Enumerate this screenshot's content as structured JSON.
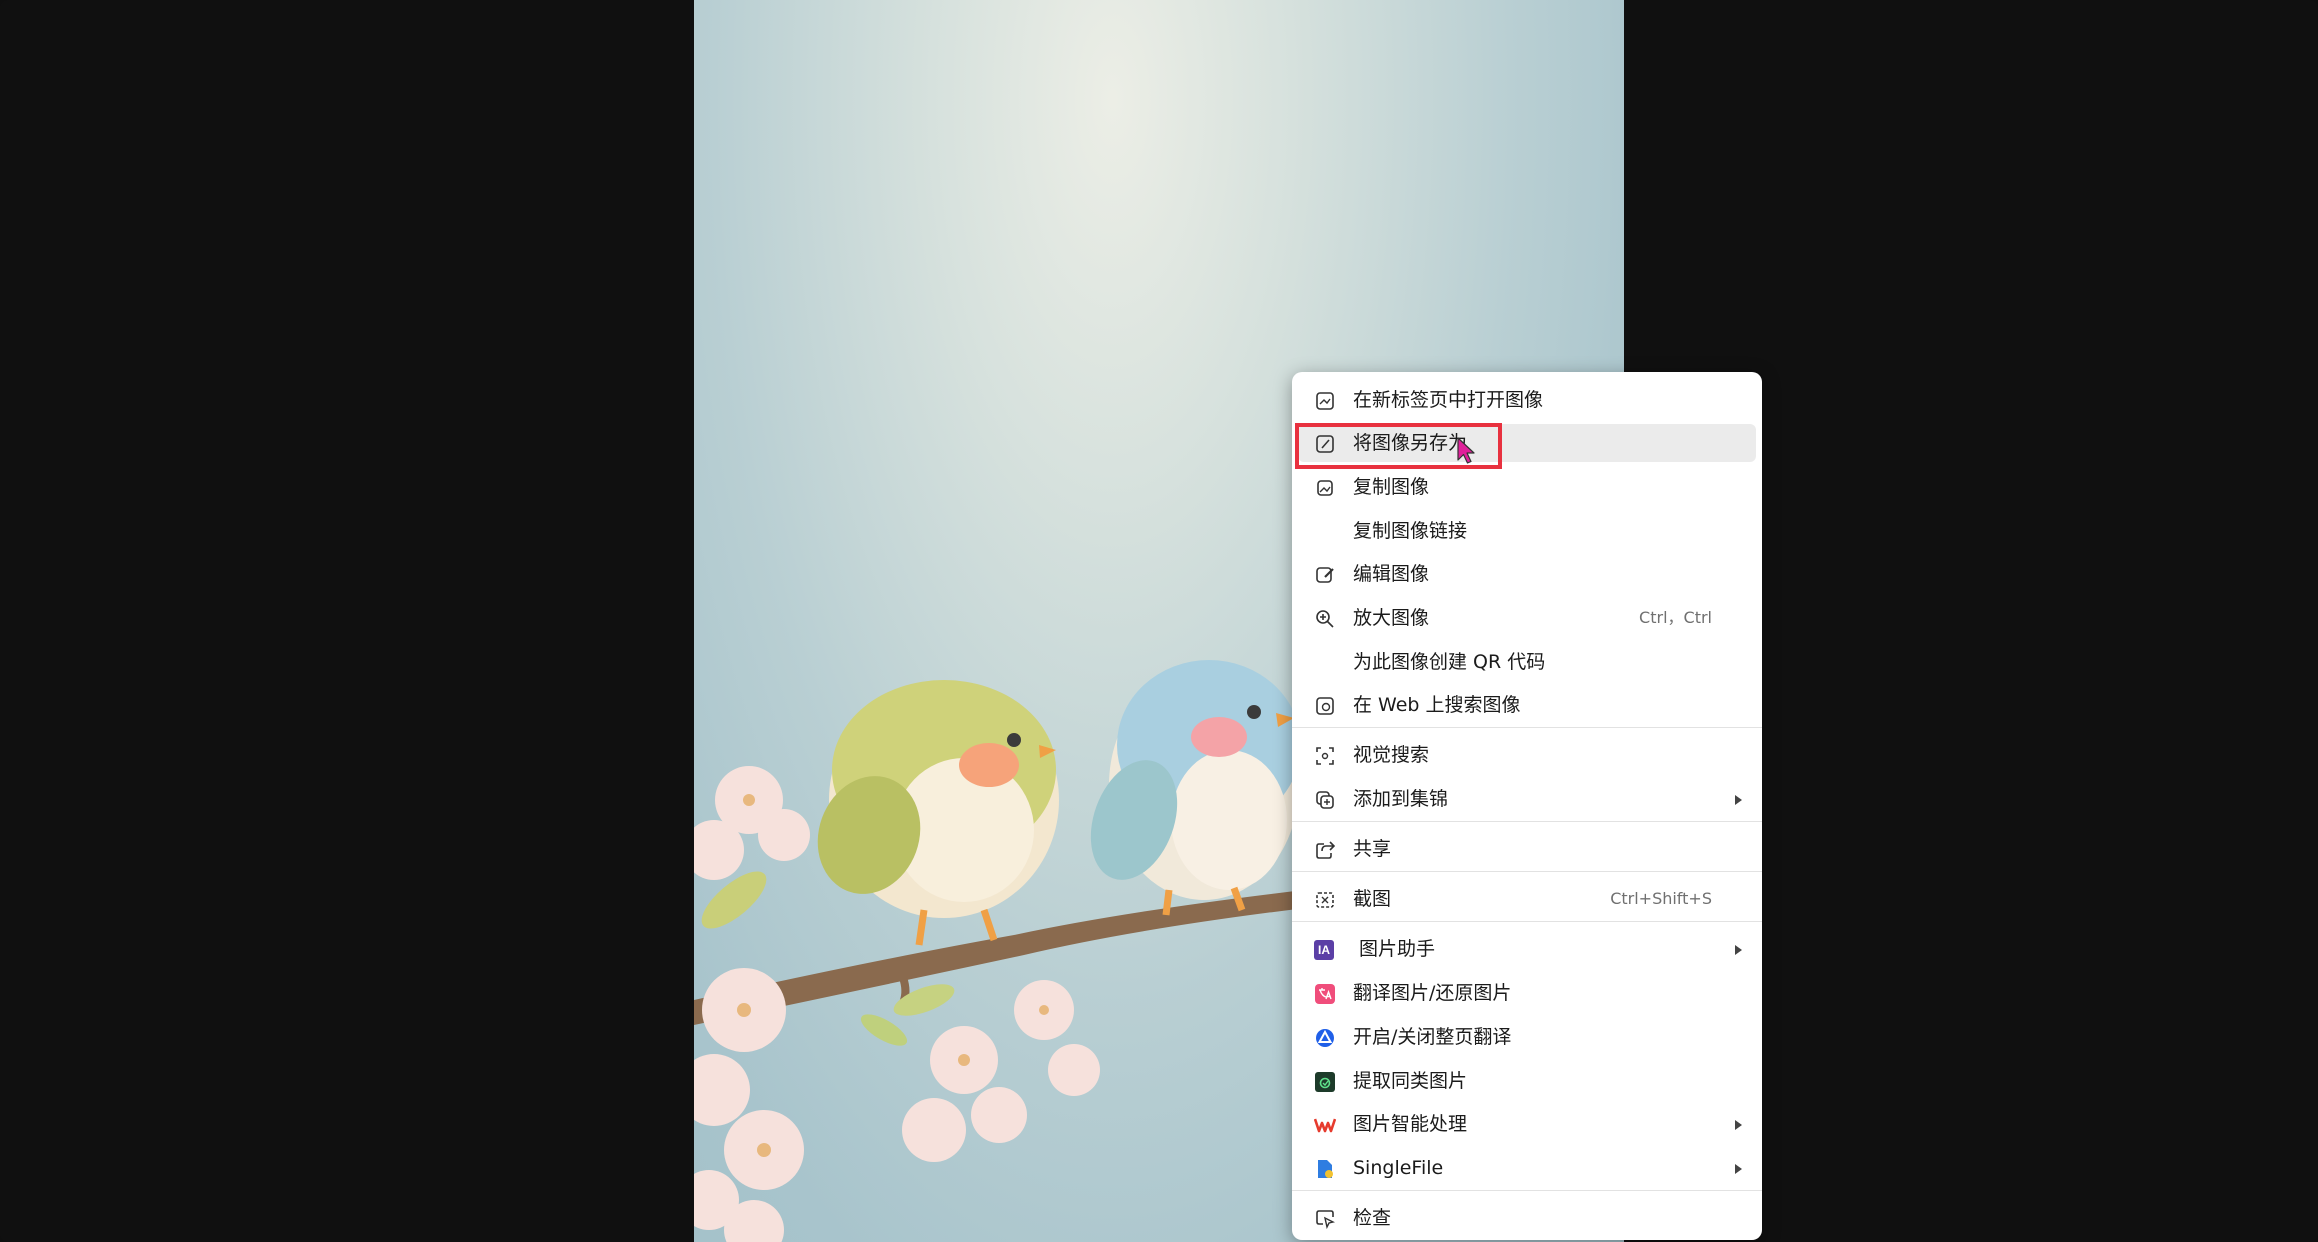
{
  "menu": {
    "items": [
      {
        "label": "在新标签页中打开图像",
        "icon": "open-in-new-tab-icon"
      },
      {
        "label": "将图像另存为",
        "icon": "save-image-icon",
        "highlighted": true
      },
      {
        "label": "复制图像",
        "icon": "copy-image-icon"
      },
      {
        "label": "复制图像链接",
        "icon": ""
      },
      {
        "label": "编辑图像",
        "icon": "edit-image-icon"
      },
      {
        "label": "放大图像",
        "icon": "zoom-in-icon",
        "shortcut": "Ctrl，Ctrl"
      },
      {
        "label": "为此图像创建 QR 代码",
        "icon": ""
      },
      {
        "label": "在 Web 上搜索图像",
        "icon": "web-image-search-icon"
      },
      {
        "label": "视觉搜索",
        "icon": "visual-search-icon"
      },
      {
        "label": "添加到集锦",
        "icon": "collections-icon",
        "submenu": true
      },
      {
        "label": "共享",
        "icon": "share-icon"
      },
      {
        "label": "截图",
        "icon": "screenshot-icon",
        "shortcut": "Ctrl+Shift+S"
      },
      {
        "label": "图片助手",
        "icon": "image-assistant-icon",
        "submenu": true
      },
      {
        "label": "翻译图片/还原图片",
        "icon": "translate-image-icon"
      },
      {
        "label": "开启/关闭整页翻译",
        "icon": "page-translate-icon"
      },
      {
        "label": "提取同类图片",
        "icon": "extract-similar-images-icon"
      },
      {
        "label": "图片智能处理",
        "icon": "wps-smart-image-icon",
        "submenu": true
      },
      {
        "label": "SingleFile",
        "icon": "singlefile-icon",
        "submenu": true
      },
      {
        "label": "检查",
        "icon": "inspect-icon"
      }
    ],
    "image_assistant_badge": "IA"
  },
  "colors": {
    "highlight_box": "#e8313f",
    "menu_bg": "#ffffff",
    "hover_bg": "#ebebeb",
    "viewer_bg": "#101010"
  }
}
